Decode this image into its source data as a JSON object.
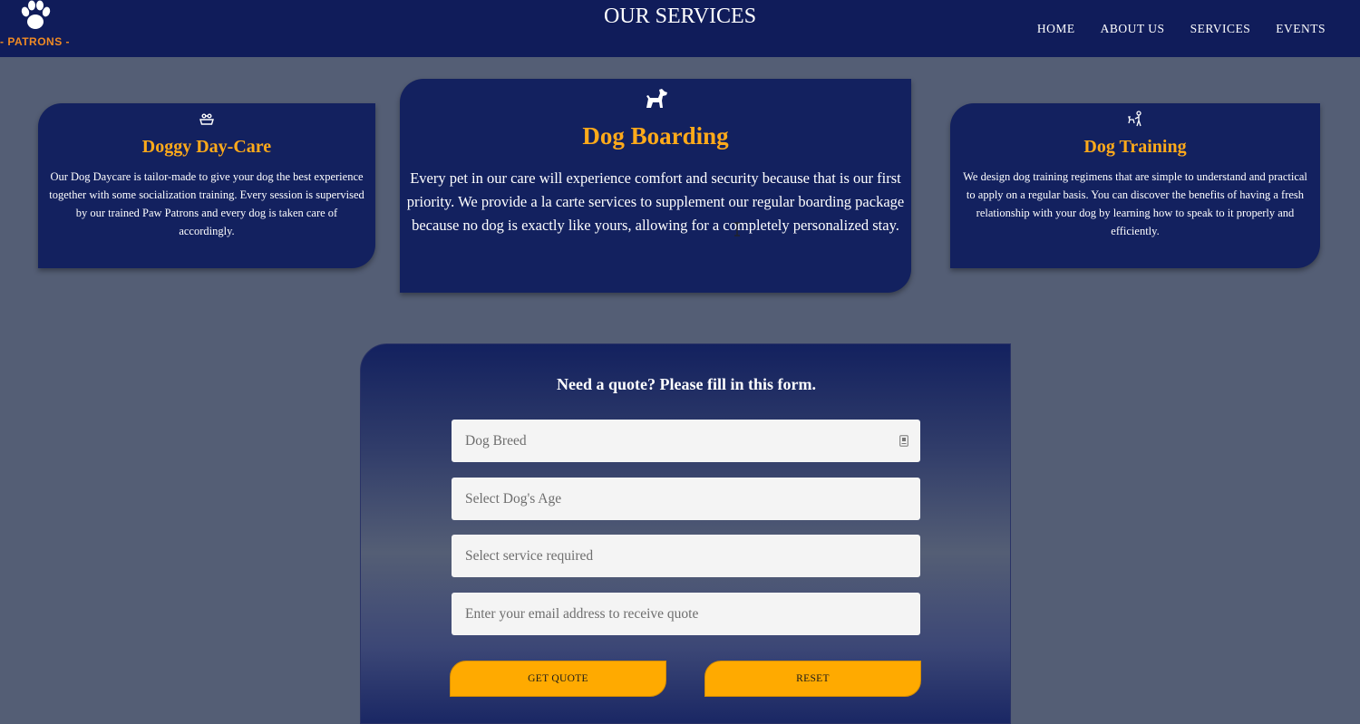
{
  "header": {
    "logo_text": "- PATRONS -",
    "page_title": "OUR SERVICES",
    "nav": [
      "HOME",
      "ABOUT US",
      "SERVICES",
      "EVENTS"
    ]
  },
  "services": [
    {
      "icon": "dog-bowl-icon",
      "title": "Doggy Day-Care",
      "text": "Our Dog Daycare is tailor-made to give your dog the best experience together with some socialization training. Every session is supervised by our trained Paw Patrons and every dog is taken care of accordingly."
    },
    {
      "icon": "dog-icon",
      "title": "Dog Boarding",
      "text": "Every pet in our care will experience comfort and security because that is our first priority. We provide a la carte services to supplement our regular boarding package because no dog is exactly like yours, allowing for a completely personalized stay."
    },
    {
      "icon": "dog-trainer-icon",
      "title": "Dog Training",
      "text": "We design dog training regimens that are simple to understand and practical to apply on a regular basis. You can discover the benefits of having a fresh relationship with your dog by learning how to speak to it properly and efficiently."
    }
  ],
  "quote_form": {
    "heading": "Need a quote? Please fill in this form.",
    "dog_breed_placeholder": "Dog Breed",
    "dog_age_placeholder": "Select Dog's Age",
    "service_placeholder": "Select service required",
    "email_placeholder": "Enter your email address to receive quote",
    "get_quote_label": "GET QUOTE",
    "reset_label": "RESET"
  },
  "colors": {
    "header_bg": "#101c5a",
    "card_bg": "#13215f",
    "accent": "#ffaa00",
    "logo_orange": "#f08a24",
    "page_bg": "#545e75"
  }
}
